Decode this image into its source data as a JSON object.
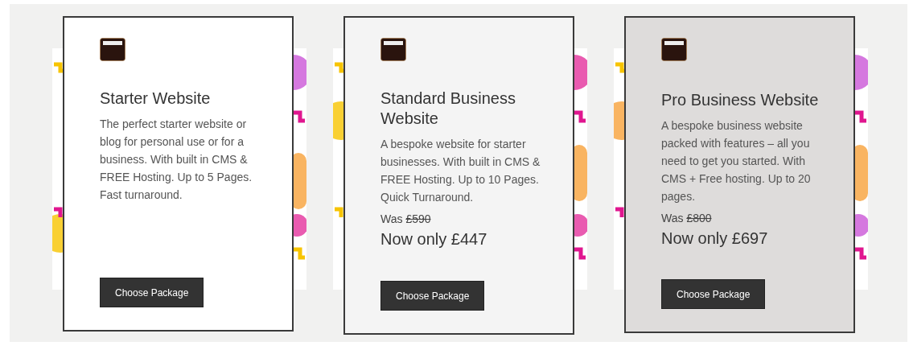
{
  "packages": [
    {
      "title": "Starter Website",
      "description": "The perfect starter website or blog for personal use or for a business. With built in CMS & FREE Hosting. Up to 5 Pages. Fast turnaround.",
      "color": "#ffffff",
      "button": "Choose Package"
    },
    {
      "title": "Standard Business Website",
      "description": "A bespoke website for starter businesses. With built in CMS & FREE Hosting. Up to 10 Pages. Quick Turnaround.",
      "was_label": "Was",
      "was_price": "£590",
      "now": "Now only £447",
      "color": "#f4f4f4",
      "button": "Choose Package"
    },
    {
      "title": "Pro Business Website",
      "description": "A bespoke business website packed with features – all you need to get you started. With CMS + Free hosting. Up to 20 pages.",
      "was_label": "Was",
      "was_price": "£800",
      "now": "Now only £697",
      "color": "#dedcdb",
      "button": "Choose Package"
    }
  ]
}
